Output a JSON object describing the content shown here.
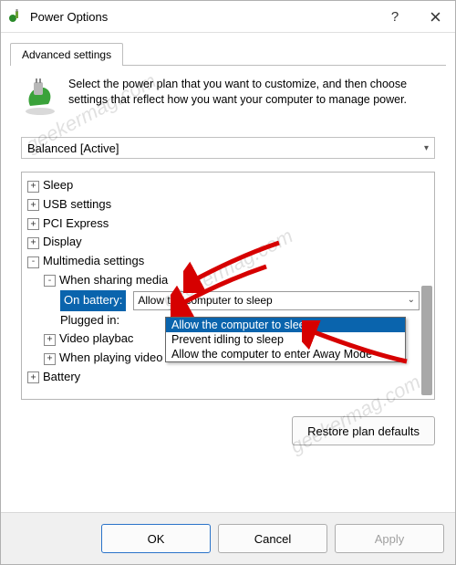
{
  "window": {
    "title": "Power Options",
    "help_glyph": "?",
    "close_glyph": "x"
  },
  "tab": {
    "label": "Advanced settings"
  },
  "intro": {
    "text": "Select the power plan that you want to customize, and then choose settings that reflect how you want your computer to manage power."
  },
  "plan_dropdown": {
    "selected": "Balanced [Active]"
  },
  "tree": {
    "items": [
      {
        "expander": "+",
        "label": "Sleep",
        "level": 1
      },
      {
        "expander": "+",
        "label": "USB settings",
        "level": 1
      },
      {
        "expander": "+",
        "label": "PCI Express",
        "level": 1
      },
      {
        "expander": "+",
        "label": "Display",
        "level": 1
      },
      {
        "expander": "-",
        "label": "Multimedia settings",
        "level": 1
      },
      {
        "expander": "-",
        "label": "When sharing media",
        "level": 2
      },
      {
        "label_prefix": "On battery:",
        "value": "Allow the computer to sleep",
        "editing": true,
        "level": 3
      },
      {
        "label_prefix": "Plugged in:",
        "value": "",
        "level": 3,
        "value_hidden": true
      },
      {
        "expander": "+",
        "label": "Video playback",
        "level": 2,
        "truncated_label": "Video playbac"
      },
      {
        "expander": "+",
        "label": "When playing video",
        "level": 2
      },
      {
        "expander": "+",
        "label": "Battery",
        "level": 1
      }
    ]
  },
  "dropdown_open": {
    "items": [
      {
        "label": "Allow the computer to sleep",
        "selected": true
      },
      {
        "label": "Prevent idling to sleep",
        "selected": false
      },
      {
        "label": "Allow the computer to enter Away Mode",
        "selected": false
      }
    ]
  },
  "buttons": {
    "restore": "Restore plan defaults",
    "ok": "OK",
    "cancel": "Cancel",
    "apply": "Apply"
  },
  "watermark": "geekermag.com"
}
